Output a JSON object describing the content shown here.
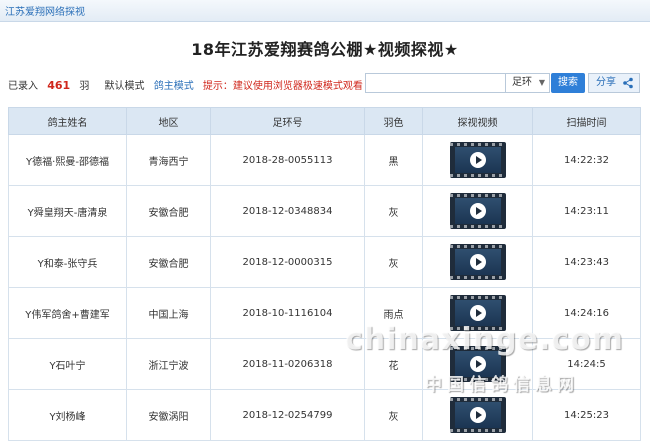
{
  "topbar": {
    "site_label": "江苏爱翔网络探视"
  },
  "page": {
    "title": "18年江苏爱翔赛鸽公棚★视频探视★"
  },
  "info": {
    "recorded_prefix": "已录入",
    "recorded_count": "461",
    "recorded_unit": "羽",
    "mode_default": "默认模式",
    "mode_owner": "鸽主模式",
    "tip": "提示：建议使用浏览器极速模式观看"
  },
  "search": {
    "input_value": "",
    "select_value": "足环",
    "button_label": "搜索",
    "share_label": "分享"
  },
  "table": {
    "headers": [
      "鸽主姓名",
      "地区",
      "足环号",
      "羽色",
      "探视视频",
      "扫描时间"
    ],
    "rows": [
      {
        "owner": "Y德福·熙曼-邵德福",
        "region": "青海西宁",
        "ring": "2018-28-0055113",
        "color": "黑",
        "video_icon": "video-play-icon",
        "time": "14:22:32"
      },
      {
        "owner": "Y舜皇翔天-唐清泉",
        "region": "安徽合肥",
        "ring": "2018-12-0348834",
        "color": "灰",
        "video_icon": "video-play-icon",
        "time": "14:23:11"
      },
      {
        "owner": "Y和泰-张守兵",
        "region": "安徽合肥",
        "ring": "2018-12-0000315",
        "color": "灰",
        "video_icon": "video-play-icon",
        "time": "14:23:43"
      },
      {
        "owner": "Y伟军鸽舍+曹建军",
        "region": "中国上海",
        "ring": "2018-10-1116104",
        "color": "雨点",
        "video_icon": "video-play-icon",
        "time": "14:24:16"
      },
      {
        "owner": "Y石叶宁",
        "region": "浙江宁波",
        "ring": "2018-11-0206318",
        "color": "花",
        "video_icon": "video-play-icon",
        "time": "14:24:5"
      },
      {
        "owner": "Y刘杨峰",
        "region": "安徽涡阳",
        "ring": "2018-12-0254799",
        "color": "灰",
        "video_icon": "video-play-icon",
        "time": "14:25:23"
      }
    ]
  },
  "watermark": {
    "line1": "chinaxinge.com",
    "line2": "中国信鸽信息网"
  },
  "colors": {
    "accent": "#2f7fd8",
    "highlight": "#d0271c",
    "header_bg": "#dbe7f3"
  }
}
